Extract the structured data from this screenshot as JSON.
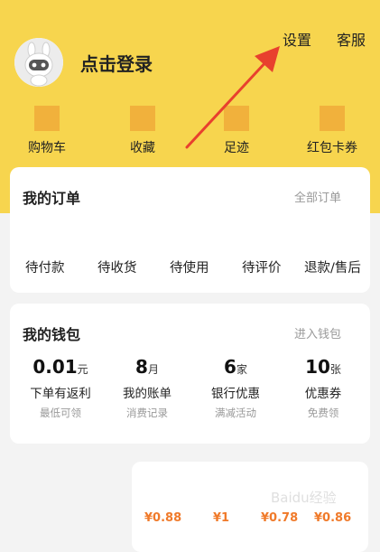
{
  "header": {
    "login_text": "点击登录",
    "settings_label": "设置",
    "service_label": "客服",
    "quick_links": [
      {
        "label": "购物车"
      },
      {
        "label": "收藏"
      },
      {
        "label": "足迹"
      },
      {
        "label": "红包卡券"
      }
    ]
  },
  "orders": {
    "title": "我的订单",
    "all_orders": "全部订单",
    "items": [
      {
        "label": "待付款"
      },
      {
        "label": "待收货"
      },
      {
        "label": "待使用"
      },
      {
        "label": "待评价"
      },
      {
        "label": "退款/售后"
      }
    ]
  },
  "wallet": {
    "title": "我的钱包",
    "enter": "进入钱包",
    "items": [
      {
        "value": "0.01",
        "unit": "元",
        "name": "下单有返利",
        "sub": "最低可领"
      },
      {
        "value": "8",
        "unit": "月",
        "name": "我的账单",
        "sub": "消费记录"
      },
      {
        "value": "6",
        "unit": "家",
        "name": "银行优惠",
        "sub": "满减活动"
      },
      {
        "value": "10",
        "unit": "张",
        "name": "优惠券",
        "sub": "免费领"
      }
    ]
  },
  "coupons": {
    "values": [
      "¥0.88",
      "¥1",
      "¥0.78",
      "¥0.86"
    ]
  },
  "watermark": "Baidu经验",
  "colors": {
    "header_bg": "#f7d54e",
    "icon_placeholder": "#f1b13c",
    "annotation_arrow": "#e8402e",
    "coupon_text": "#f07a2a"
  }
}
